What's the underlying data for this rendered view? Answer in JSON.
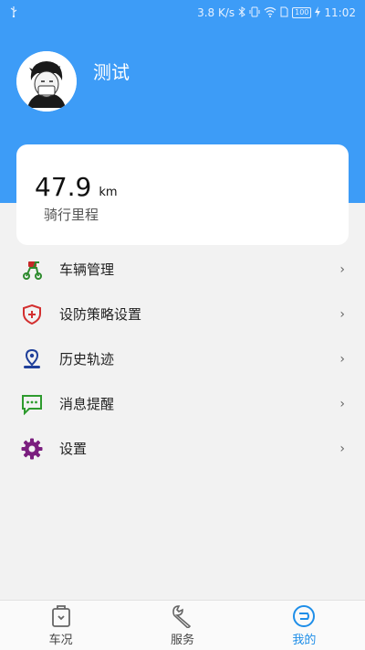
{
  "status_bar": {
    "left_icon": "usb-icon",
    "speed": "3.8 K/s",
    "battery": "100",
    "time": "11:02"
  },
  "profile": {
    "name": "测试"
  },
  "stats": {
    "mileage_value": "47.9",
    "mileage_unit": "km",
    "mileage_label": "骑行里程"
  },
  "menu": {
    "items": [
      {
        "label": "车辆管理",
        "icon": "scooter-icon"
      },
      {
        "label": "设防策略设置",
        "icon": "shield-icon"
      },
      {
        "label": "历史轨迹",
        "icon": "location-pin-icon"
      },
      {
        "label": "消息提醒",
        "icon": "message-icon"
      },
      {
        "label": "设置",
        "icon": "gear-icon"
      }
    ],
    "chevron": "›"
  },
  "tabs": [
    {
      "label": "车况",
      "icon": "car-status-icon"
    },
    {
      "label": "服务",
      "icon": "wrench-icon"
    },
    {
      "label": "我的",
      "icon": "my-profile-icon"
    }
  ],
  "colors": {
    "header_blue": "#3d9cf7",
    "active_tab": "#1e8ee8"
  }
}
